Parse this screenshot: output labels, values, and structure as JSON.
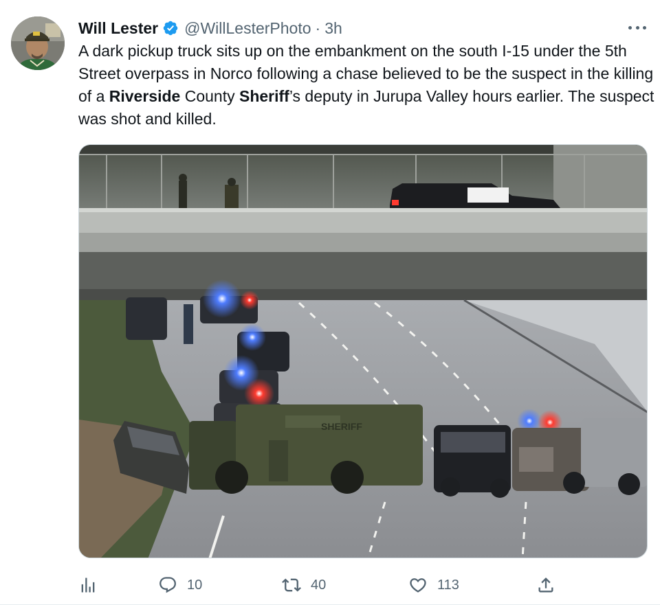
{
  "tweet": {
    "author_name": "Will Lester",
    "handle": "@WillLesterPhoto",
    "separator": "·",
    "time": "3h",
    "text_parts": [
      "A dark pickup truck sits up on the embankment on the south I-15 under the 5th Street overpass in Norco following a chase believed to be the suspect in the killing of a ",
      "Riverside",
      " County ",
      "Sheriff",
      "’s deputy in Jurupa Valley hours earlier. The suspect was shot and killed."
    ],
    "media": {
      "vehicle_labels": [
        "SHERIFF"
      ]
    }
  },
  "actions": {
    "replies": "10",
    "retweets": "40",
    "likes": "113"
  },
  "colors": {
    "verified": "#1d9bf0",
    "icon_gray": "#536471",
    "text": "#0f1419"
  },
  "icons": {
    "more": "more-horizontal-icon",
    "verified": "verified-badge-icon",
    "analytics": "analytics-icon",
    "reply": "reply-icon",
    "retweet": "retweet-icon",
    "like": "heart-icon",
    "share": "share-icon"
  }
}
